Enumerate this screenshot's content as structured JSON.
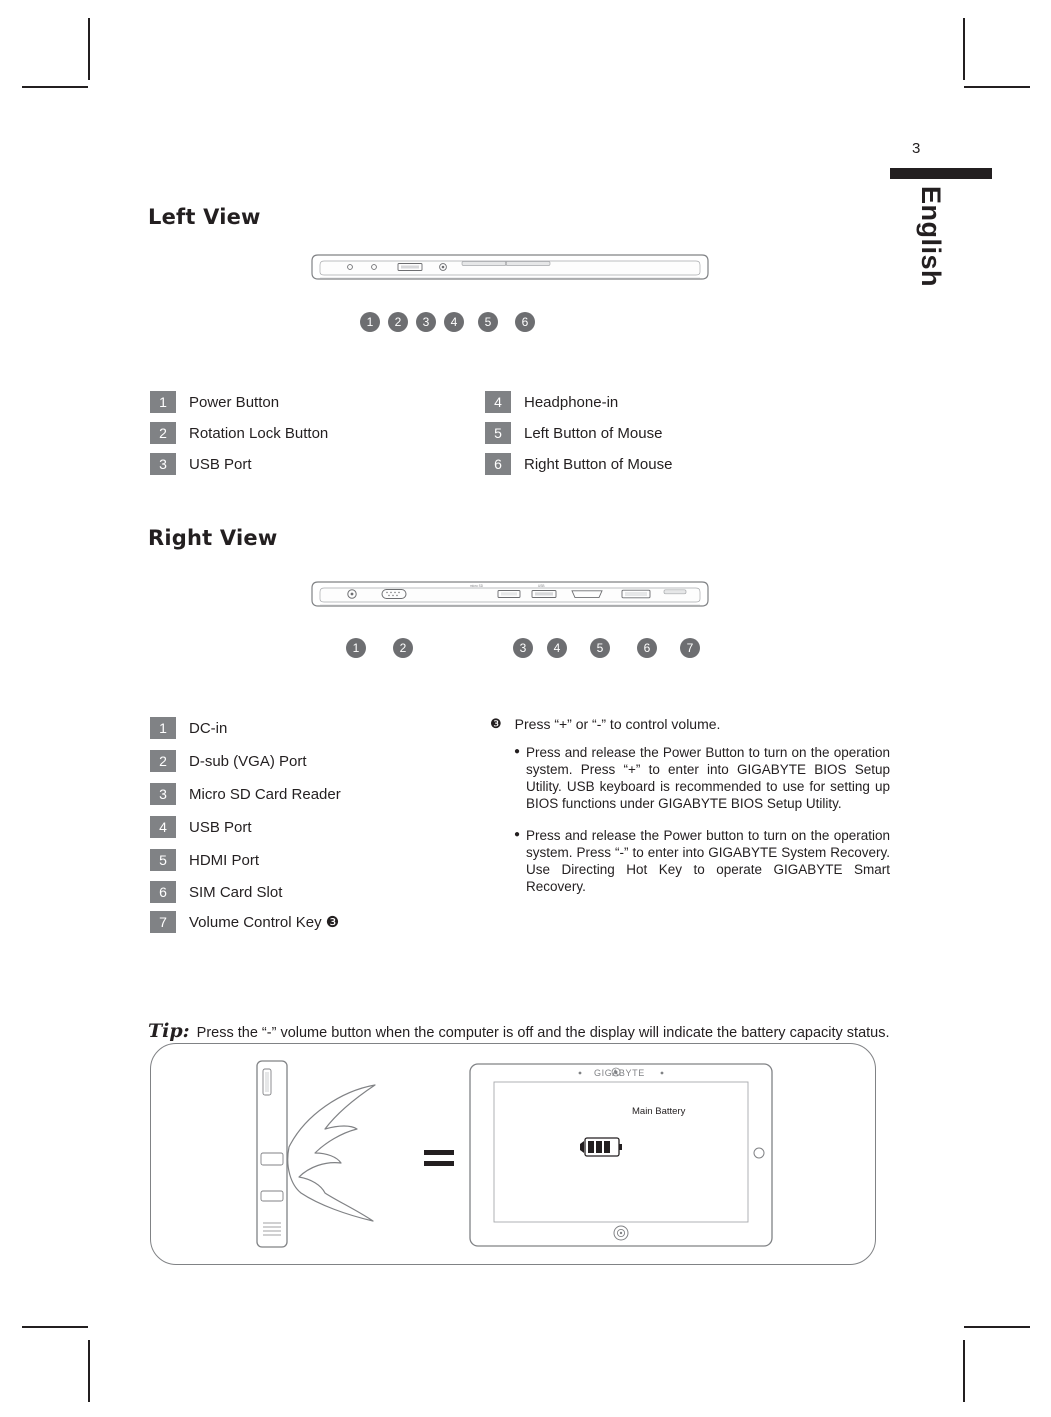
{
  "page": {
    "number": "3",
    "language_tab": "English"
  },
  "sections": [
    {
      "id": "left-view",
      "title": "Left View"
    },
    {
      "id": "right-view",
      "title": "Right View"
    }
  ],
  "left_view": {
    "callout_numbers": [
      "1",
      "2",
      "3",
      "4",
      "5",
      "6"
    ],
    "legend_left": [
      {
        "num": "1",
        "label": "Power Button"
      },
      {
        "num": "2",
        "label": "Rotation Lock Button"
      },
      {
        "num": "3",
        "label": "USB Port"
      }
    ],
    "legend_right": [
      {
        "num": "4",
        "label": "Headphone-in"
      },
      {
        "num": "5",
        "label": "Left Button of Mouse"
      },
      {
        "num": "6",
        "label": "Right Button of Mouse"
      }
    ]
  },
  "right_view": {
    "callout_numbers": [
      "1",
      "2",
      "3",
      "4",
      "5",
      "6",
      "7"
    ],
    "legend": [
      {
        "num": "1",
        "label": "DC-in"
      },
      {
        "num": "2",
        "label": "D-sub (VGA) Port"
      },
      {
        "num": "3",
        "label": "Micro SD Card Reader"
      },
      {
        "num": "4",
        "label": "USB Port"
      },
      {
        "num": "5",
        "label": "HDMI Port"
      },
      {
        "num": "6",
        "label": "SIM Card Slot"
      },
      {
        "num": "7",
        "label": "Volume Control Key ❸"
      }
    ],
    "note": {
      "marker": "❸",
      "heading": "Press “+” or “-” to control volume.",
      "items": [
        "Press and release the Power Button to turn on the operation system. Press “+” to enter into GIGABYTE BIOS Setup Utility. USB keyboard is recommended to use for setting up BIOS functions under GIGABYTE BIOS Setup Utility.",
        "Press and release the Power button to turn on the operation system. Press “-” to enter into GIGABYTE System Recovery. Use Directing Hot Key to operate GIGABYTE Smart Recovery."
      ]
    }
  },
  "tip": {
    "label": "Tip:",
    "text": "Press the “-” volume button when the computer is off and the display will indicate the battery capacity status."
  },
  "illustration": {
    "brand": "GIGABYTE",
    "battery_label": "Main Battery",
    "equals_sign": "="
  },
  "colors": {
    "text": "#231f20",
    "badge_gray": "#808285",
    "circle_gray": "#6d6e71",
    "line_gray": "#808285"
  }
}
